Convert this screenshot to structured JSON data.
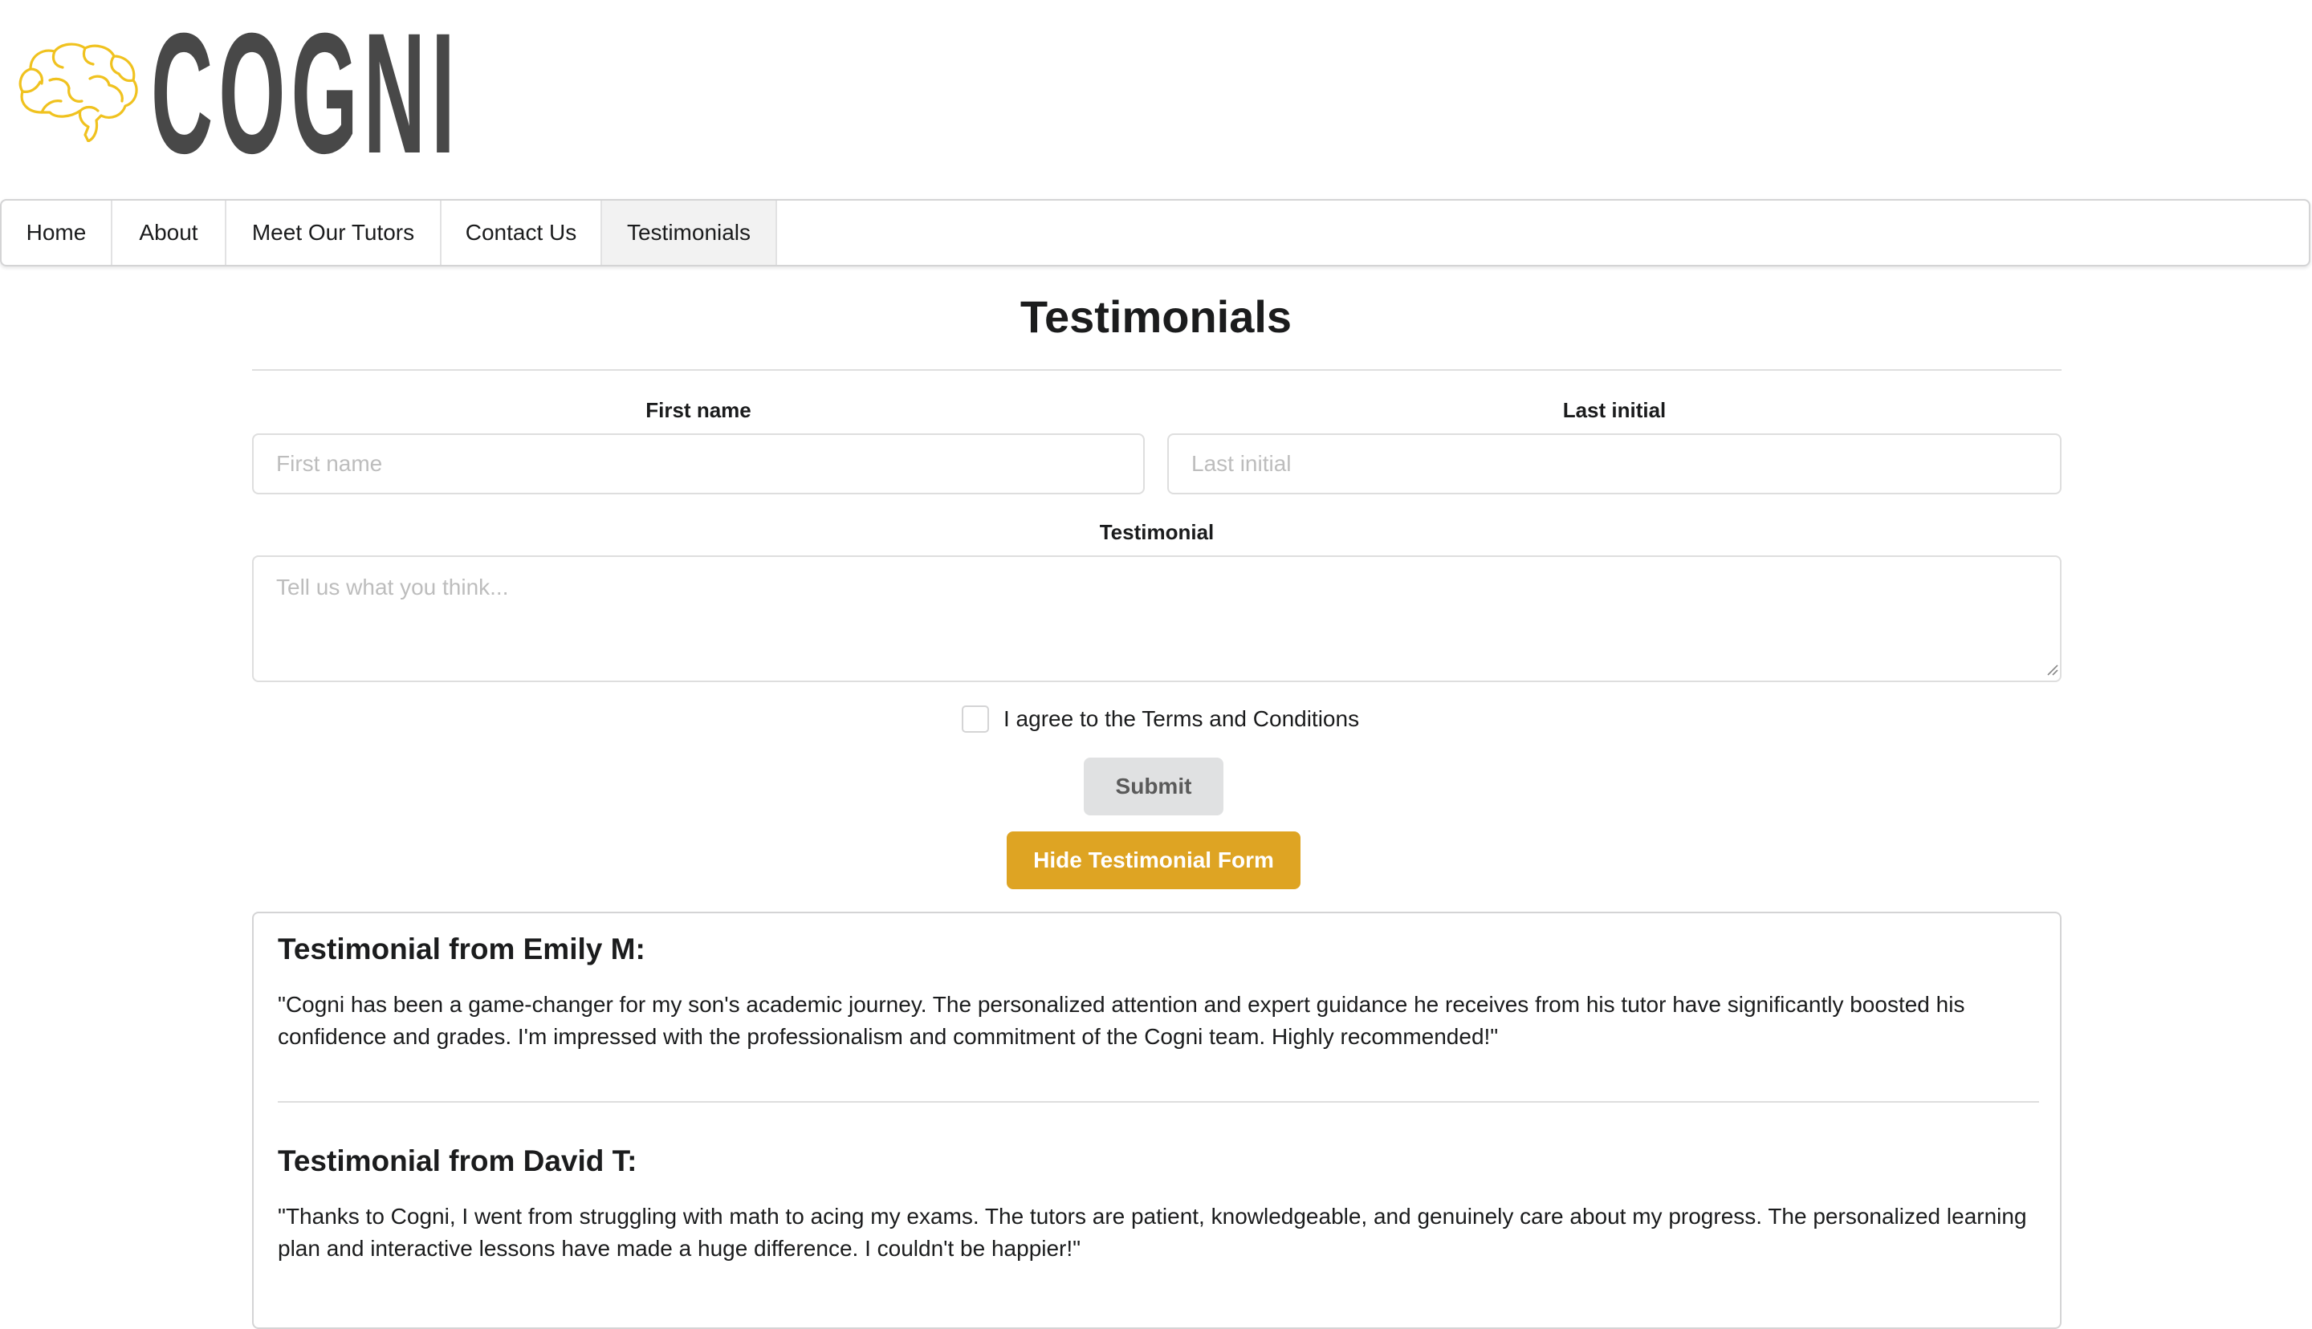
{
  "brand": {
    "name": "COGNI",
    "logo_icon": "brain-icon",
    "accent_color": "#f0c21f"
  },
  "nav": {
    "items": [
      {
        "label": "Home"
      },
      {
        "label": "About"
      },
      {
        "label": "Meet Our Tutors"
      },
      {
        "label": "Contact Us"
      },
      {
        "label": "Testimonials",
        "active": true
      }
    ]
  },
  "page": {
    "title": "Testimonials"
  },
  "form": {
    "first_name": {
      "label": "First name",
      "placeholder": "First name",
      "value": ""
    },
    "last_initial": {
      "label": "Last initial",
      "placeholder": "Last initial",
      "value": ""
    },
    "testimonial": {
      "label": "Testimonial",
      "placeholder": "Tell us what you think...",
      "value": ""
    },
    "terms": {
      "label": "I agree to the Terms and Conditions",
      "checked": false
    },
    "submit_label": "Submit",
    "hide_label": "Hide Testimonial Form",
    "hide_button_color": "#dea423"
  },
  "testimonials": [
    {
      "heading": "Testimonial from Emily M:",
      "text": "\"Cogni has been a game-changer for my son's academic journey. The personalized attention and expert guidance he receives from his tutor have significantly boosted his confidence and grades. I'm impressed with the professionalism and commitment of the Cogni team. Highly recommended!\""
    },
    {
      "heading": "Testimonial from David T:",
      "text": "\"Thanks to Cogni, I went from struggling with math to acing my exams. The tutors are patient, knowledgeable, and genuinely care about my progress. The personalized learning plan and interactive lessons have made a huge difference. I couldn't be happier!\""
    }
  ]
}
